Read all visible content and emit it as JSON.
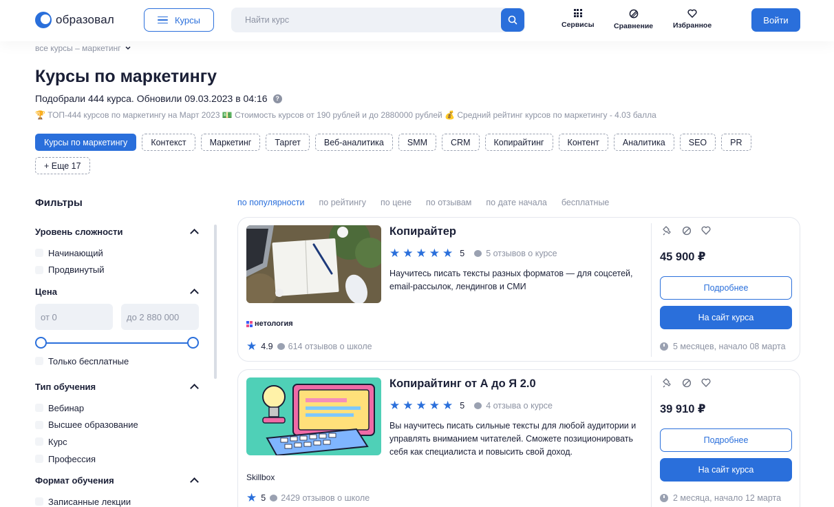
{
  "header": {
    "logo_text": "образовал",
    "courses_label": "Курсы",
    "search_placeholder": "Найти курс",
    "nav": {
      "services": "Сервисы",
      "compare": "Сравнение",
      "favorites": "Избранное"
    },
    "login_label": "Войти"
  },
  "breadcrumb": {
    "text": "все курсы – маркетинг"
  },
  "page": {
    "title": "Курсы по маркетингу",
    "subtitle": "Подобрали 444 курса. Обновили 09.03.2023 в 04:16",
    "stats": "🏆 ТОП-444 курсов по маркетингу на Март 2023 💵 Стоимость курсов от 190 рублей и до 2880000 рублей 💰 Средний рейтинг курсов по маркетингу - 4.03 балла"
  },
  "tags": [
    "Курсы по маркетингу",
    "Контекст",
    "Маркетинг",
    "Таргет",
    "Веб-аналитика",
    "SMM",
    "CRM",
    "Копирайтинг",
    "Контент",
    "Аналитика",
    "SEO",
    "PR",
    "+ Еще 17"
  ],
  "filters": {
    "title": "Фильтры",
    "level": {
      "title": "Уровень сложности",
      "options": [
        "Начинающий",
        "Продвинутый"
      ]
    },
    "price": {
      "title": "Цена",
      "from_placeholder": "от 0",
      "to_placeholder": "до 2 880 000",
      "free_only": "Только бесплатные"
    },
    "type": {
      "title": "Тип обучения",
      "options": [
        "Вебинар",
        "Высшее образование",
        "Курс",
        "Профессия"
      ]
    },
    "format": {
      "title": "Формат обучения",
      "options": [
        "Записанные лекции"
      ]
    }
  },
  "sort": {
    "options": [
      "по популярности",
      "по рейтингу",
      "по цене",
      "по отзывам",
      "по дате начала",
      "бесплатные"
    ],
    "active": 0
  },
  "courses": [
    {
      "title": "Копирайтер",
      "rating": "5",
      "reviews": "5 отзывов о курсе",
      "description": "Научитесь писать тексты разных форматов — для соцсетей, email-рассылок, лендингов и СМИ",
      "school": "нетология",
      "school_rating": "4.9",
      "school_reviews": "614 отзывов о школе",
      "price": "45 900 ₽",
      "more_label": "Подробнее",
      "site_label": "На сайт курса",
      "duration": "5 месяцев, начало 08 марта"
    },
    {
      "title": "Копирайтинг от А до Я 2.0",
      "rating": "5",
      "reviews": "4 отзыва о курсе",
      "description": "Вы научитесь писать сильные тексты для любой аудитории и управлять вниманием читателей. Сможете позиционировать себя как специалиста и повысить свой доход.",
      "school": "Skillbox",
      "school_rating": "5",
      "school_reviews": "2429 отзывов о школе",
      "price": "39 910 ₽",
      "more_label": "Подробнее",
      "site_label": "На сайт курса",
      "duration": "2 месяца, начало 12 марта"
    }
  ],
  "colors": {
    "accent": "#2a6fdb",
    "text": "#1a1f36",
    "muted": "#8d93a3"
  }
}
